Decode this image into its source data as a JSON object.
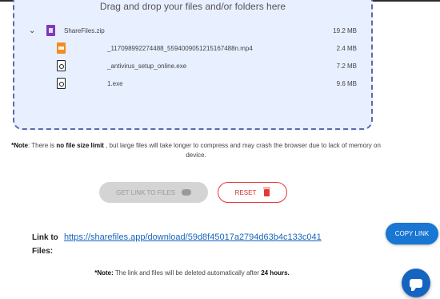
{
  "dropzone": {
    "prompt": "Drag and drop your files and/or folders here",
    "zip": {
      "name": "ShareFiles.zip",
      "size": "19.2 MB",
      "icon": "zip-file-icon"
    },
    "files": [
      {
        "name": "_117098992274488_5594009051215167488n.mp4",
        "size": "2.4 MB",
        "icon": "video-file-icon"
      },
      {
        "name": "_antivirus_setup_online.exe",
        "size": "7.2 MB",
        "icon": "exe-file-icon"
      },
      {
        "name": "1.exe",
        "size": "9.6 MB",
        "icon": "exe-file-icon"
      }
    ]
  },
  "note": {
    "prefix": "*Note",
    "text1": ": There is ",
    "bold": "no file size limit",
    "text2": " , but large files will take longer to compress and may crash the browser due to lack of memory on device."
  },
  "buttons": {
    "get_link": "GET LINK TO FILES",
    "reset": "RESET",
    "copy_link": "COPY LINK"
  },
  "link": {
    "label_line1": "Link to",
    "label_line2": "Files:",
    "url": "https://sharefiles.app/download/59d8f45017a2794d63b4c133c041"
  },
  "note2": {
    "prefix": "*Note:",
    "text": " The link and files will be deleted automatically after ",
    "bold": "24 hours."
  },
  "colors": {
    "accent": "#1976d2",
    "reset": "#e53935",
    "dropzone_bg": "#e8efff"
  }
}
